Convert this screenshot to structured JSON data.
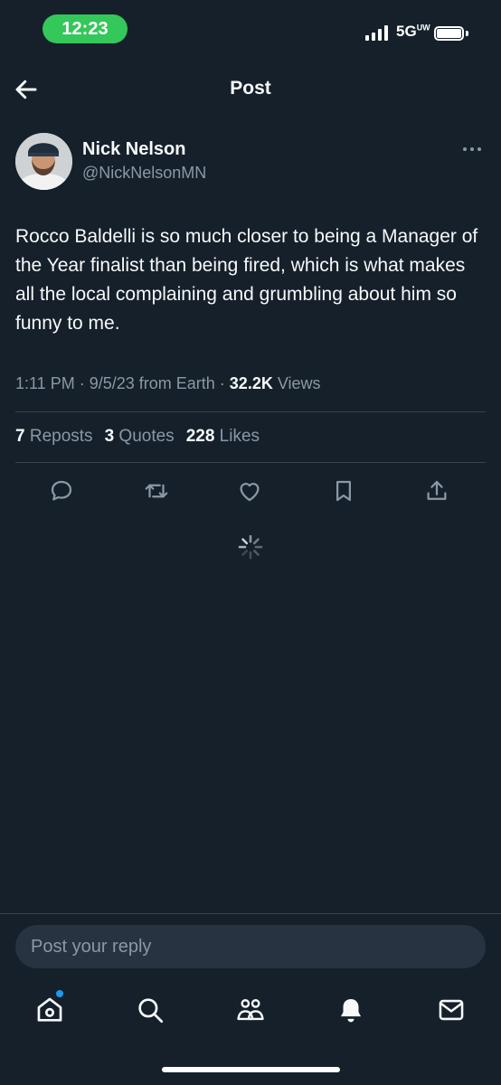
{
  "status_bar": {
    "time": "12:23",
    "network": "5G",
    "network_superscript": "UW",
    "time_pill_color": "#34c759"
  },
  "header": {
    "title": "Post",
    "back_icon": "arrow-left-icon"
  },
  "post": {
    "author_name": "Nick Nelson",
    "author_handle": "@NickNelsonMN",
    "text": "Rocco Baldelli is so much closer to being a Manager of the Year finalist than being fired, which is what makes all the local complaining and grumbling about him so funny to me.",
    "time": "1:11 PM",
    "date": "9/5/23",
    "source": "from Earth",
    "views_count": "32.2K",
    "views_label": "Views",
    "reposts_count": "7",
    "reposts_label": "Reposts",
    "quotes_count": "3",
    "quotes_label": "Quotes",
    "likes_count": "228",
    "likes_label": "Likes"
  },
  "actions": [
    "reply-icon",
    "repost-icon",
    "like-icon",
    "bookmark-icon",
    "share-icon"
  ],
  "reply": {
    "placeholder": "Post your reply"
  },
  "tab_bar": [
    "home-icon",
    "search-icon",
    "communities-icon",
    "notifications-icon",
    "messages-icon"
  ],
  "colors": {
    "background": "#15202b",
    "text": "#f7f9f9",
    "muted": "#8b98a5",
    "accent": "#1d9bf0",
    "divider": "#38444d"
  }
}
